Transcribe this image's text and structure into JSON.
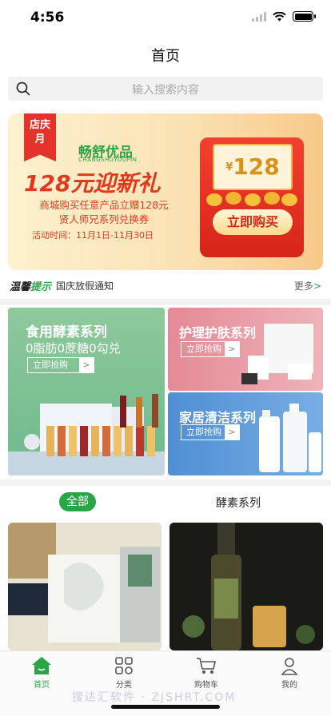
{
  "status_bar": {
    "time": "4:56"
  },
  "nav": {
    "title": "首页"
  },
  "search": {
    "placeholder": "输入搜索内容"
  },
  "banner": {
    "ribbon": "店庆月",
    "brand": "畅舒优品",
    "brand_sub": "CHANGSHUYOUPIN",
    "headline": "128元迎新礼",
    "line1": "商城购买任意产品立赠128元",
    "line2": "贤人师兄系列兑换券",
    "date": "活动时间：11月1日-11月30日",
    "coupon_currency": "¥",
    "coupon_amount": "128",
    "button": "立即购买"
  },
  "notice": {
    "badge_a": "温馨",
    "badge_b": "提示",
    "text": "国庆放假通知",
    "more": "更多",
    "more_arrow": ">"
  },
  "categories": [
    {
      "title": "食用酵素系列",
      "subtitle": "0脂肪0蔗糖0勾兑",
      "button": "立即抢购",
      "chev": ">"
    },
    {
      "title": "护理护肤系列",
      "button": "立即抢购",
      "chev": ">"
    },
    {
      "title": "家居清洁系列",
      "button": "立即抢购",
      "chev": ">"
    }
  ],
  "tabs": [
    {
      "label": "全部"
    },
    {
      "label": "酵素系列"
    }
  ],
  "tabbar": [
    {
      "label": "首页"
    },
    {
      "label": "分类"
    },
    {
      "label": "购物车"
    },
    {
      "label": "我的"
    }
  ],
  "watermark": "搜达汇软件 · ZJSHRT.COM",
  "colors": {
    "accent": "#2aa547",
    "banner_red": "#e03a1e"
  }
}
